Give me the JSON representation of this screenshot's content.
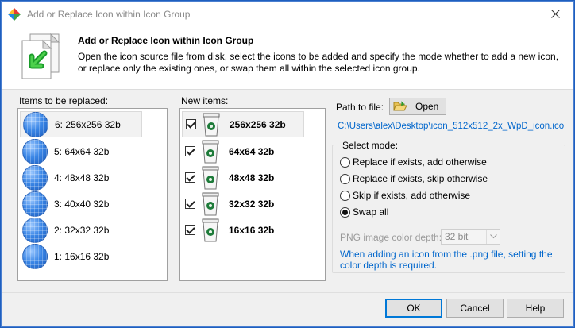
{
  "window": {
    "title": "Add or Replace Icon within Icon Group"
  },
  "header": {
    "title": "Add or Replace Icon within Icon Group",
    "description": "Open the icon source file from disk, select the icons to be added and specify the mode whether to add a new icon, or replace only the existing ones, or swap them all within the selected icon group."
  },
  "replaced": {
    "label": "Items to be replaced:",
    "items": [
      {
        "label": "6: 256x256 32b",
        "selected": true
      },
      {
        "label": "5: 64x64 32b"
      },
      {
        "label": "4: 48x48 32b"
      },
      {
        "label": "3: 40x40 32b"
      },
      {
        "label": "2: 32x32 32b"
      },
      {
        "label": "1: 16x16 32b"
      }
    ]
  },
  "new_items": {
    "label": "New items:",
    "items": [
      {
        "label": "256x256 32b",
        "checked": true,
        "selected": true
      },
      {
        "label": "64x64 32b",
        "checked": true
      },
      {
        "label": "48x48 32b",
        "checked": true
      },
      {
        "label": "32x32 32b",
        "checked": true
      },
      {
        "label": "16x16 32b",
        "checked": true
      }
    ]
  },
  "path": {
    "label": "Path to file:",
    "open_label": "Open",
    "file_path": "C:\\Users\\alex\\Desktop\\icon_512x512_2x_WpD_icon.ico"
  },
  "mode": {
    "label": "Select mode:",
    "options": [
      {
        "label": "Replace if exists, add otherwise",
        "selected": false
      },
      {
        "label": "Replace if exists, skip otherwise",
        "selected": false
      },
      {
        "label": "Skip if exists, add otherwise",
        "selected": false
      },
      {
        "label": "Swap all",
        "selected": true
      }
    ],
    "depth_label": "PNG image color depth:",
    "depth_value": "32 bit",
    "hint": "When adding an icon from the .png file, setting the color depth is required."
  },
  "buttons": {
    "ok": "OK",
    "cancel": "Cancel",
    "help": "Help"
  },
  "colors": {
    "accent": "#0078d7",
    "link": "#0066cc"
  }
}
